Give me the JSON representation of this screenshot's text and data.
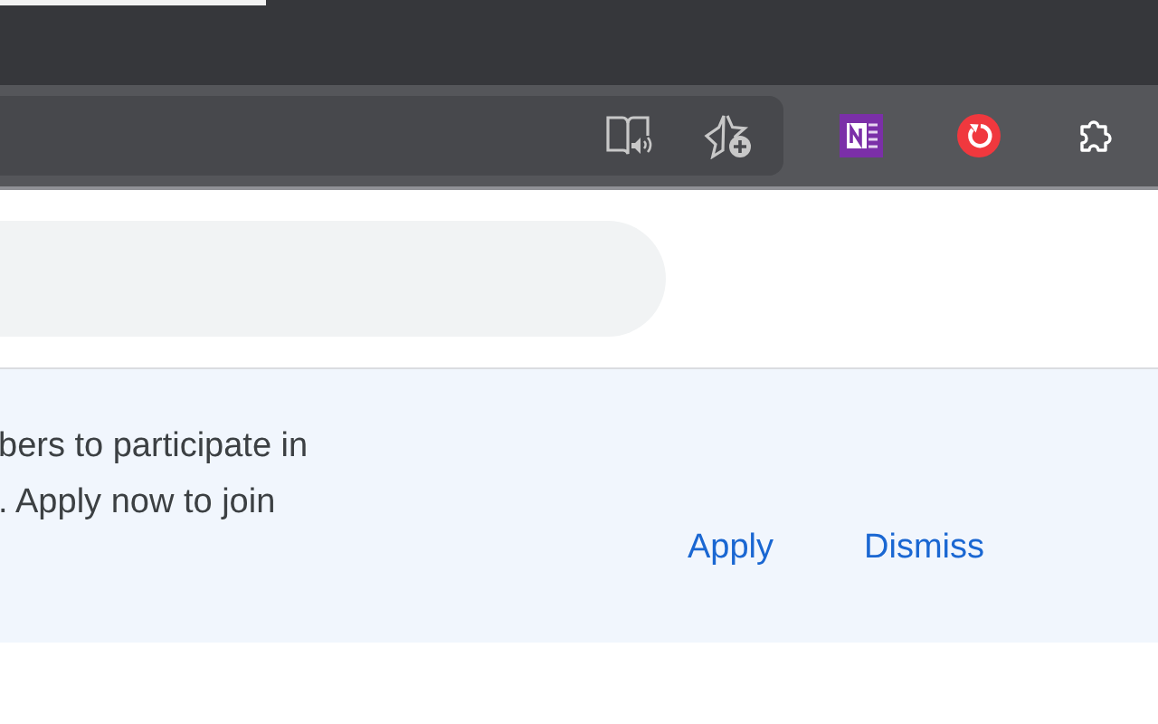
{
  "banner": {
    "lines": [
      "bers to participate in",
      ". Apply now to join"
    ],
    "buttons": [
      "Apply",
      "Dismiss"
    ]
  }
}
